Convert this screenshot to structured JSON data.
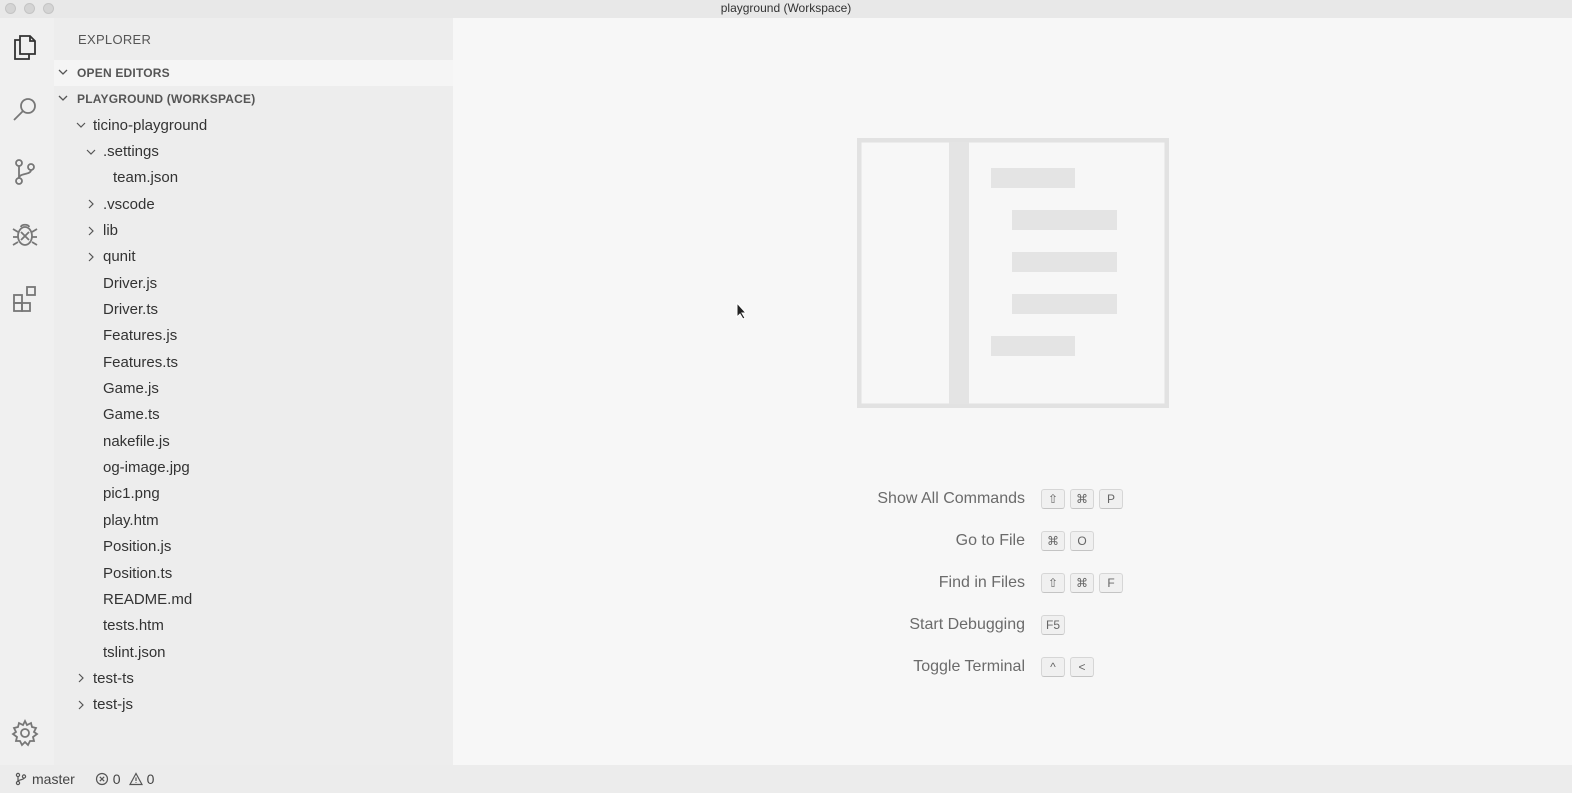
{
  "window": {
    "title": "playground (Workspace)"
  },
  "activity_bar": {
    "items": [
      {
        "icon": "files-icon"
      },
      {
        "icon": "search-icon"
      },
      {
        "icon": "source-control-icon"
      },
      {
        "icon": "debug-icon"
      },
      {
        "icon": "extensions-icon"
      }
    ],
    "settings_icon": "gear-icon"
  },
  "sidebar": {
    "title": "EXPLORER",
    "open_editors_label": "OPEN EDITORS",
    "workspace_label": "PLAYGROUND (WORKSPACE)",
    "tree": [
      {
        "label": "ticino-playground",
        "depth": 0,
        "twistie": "open"
      },
      {
        "label": ".settings",
        "depth": 1,
        "twistie": "open"
      },
      {
        "label": "team.json",
        "depth": 2,
        "twistie": "none"
      },
      {
        "label": ".vscode",
        "depth": 1,
        "twistie": "closed"
      },
      {
        "label": "lib",
        "depth": 1,
        "twistie": "closed"
      },
      {
        "label": "qunit",
        "depth": 1,
        "twistie": "closed"
      },
      {
        "label": "Driver.js",
        "depth": 1,
        "twistie": "none"
      },
      {
        "label": "Driver.ts",
        "depth": 1,
        "twistie": "none"
      },
      {
        "label": "Features.js",
        "depth": 1,
        "twistie": "none"
      },
      {
        "label": "Features.ts",
        "depth": 1,
        "twistie": "none"
      },
      {
        "label": "Game.js",
        "depth": 1,
        "twistie": "none"
      },
      {
        "label": "Game.ts",
        "depth": 1,
        "twistie": "none"
      },
      {
        "label": "nakefile.js",
        "depth": 1,
        "twistie": "none"
      },
      {
        "label": "og-image.jpg",
        "depth": 1,
        "twistie": "none"
      },
      {
        "label": "pic1.png",
        "depth": 1,
        "twistie": "none"
      },
      {
        "label": "play.htm",
        "depth": 1,
        "twistie": "none"
      },
      {
        "label": "Position.js",
        "depth": 1,
        "twistie": "none"
      },
      {
        "label": "Position.ts",
        "depth": 1,
        "twistie": "none"
      },
      {
        "label": "README.md",
        "depth": 1,
        "twistie": "none"
      },
      {
        "label": "tests.htm",
        "depth": 1,
        "twistie": "none"
      },
      {
        "label": "tslint.json",
        "depth": 1,
        "twistie": "none"
      },
      {
        "label": "test-ts",
        "depth": 0,
        "twistie": "closed"
      },
      {
        "label": "test-js",
        "depth": 0,
        "twistie": "closed"
      }
    ]
  },
  "editor": {
    "shortcuts": [
      {
        "label": "Show All Commands",
        "keys": [
          "⇧",
          "⌘",
          "P"
        ]
      },
      {
        "label": "Go to File",
        "keys": [
          "⌘",
          "O"
        ]
      },
      {
        "label": "Find in Files",
        "keys": [
          "⇧",
          "⌘",
          "F"
        ]
      },
      {
        "label": "Start Debugging",
        "keys": [
          "F5"
        ]
      },
      {
        "label": "Toggle Terminal",
        "keys": [
          "^",
          "<"
        ]
      }
    ]
  },
  "status_bar": {
    "branch": "master",
    "errors": "0",
    "warnings": "0"
  },
  "colors": {
    "background": "#f3f3f3",
    "sidebar": "#ededed",
    "editor": "#f7f7f7",
    "watermark": "#e4e4e4"
  }
}
